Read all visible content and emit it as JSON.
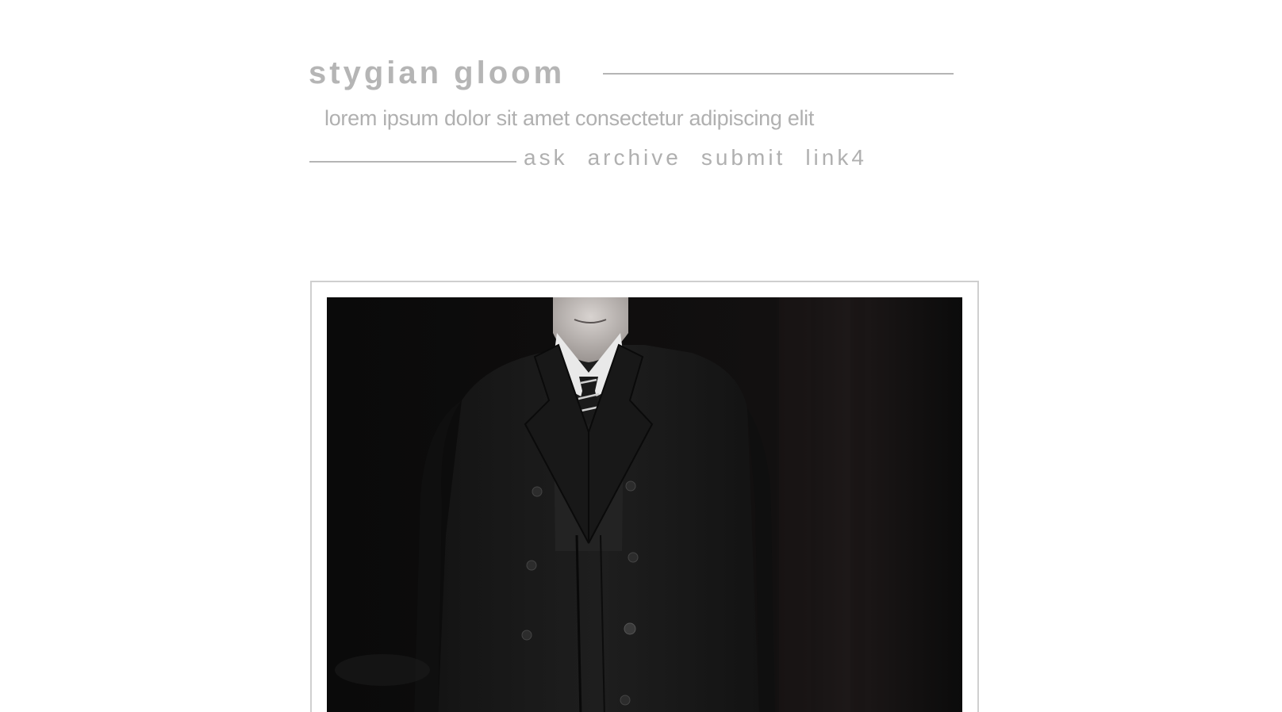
{
  "blog": {
    "title": "stygian gloom",
    "description": "lorem ipsum dolor sit amet consectetur adipiscing elit"
  },
  "nav": {
    "links": [
      "ask",
      "archive",
      "submit",
      "link4"
    ]
  },
  "colors": {
    "text_gray": "#b5b5b5",
    "frame_border": "#cfcfcf",
    "background": "#ffffff"
  },
  "post": {
    "image_subject": "model in black double-breasted overcoat, white shirt and striped tie on dark runway"
  }
}
